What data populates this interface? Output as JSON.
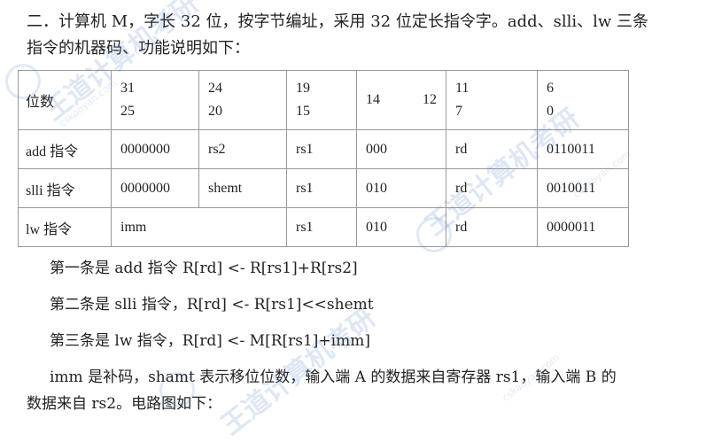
{
  "intro": {
    "line1": "二．计算机 M，字长 32 位，按字节编址，采用 32 位定长指令字。add、slli、lw 三条",
    "line2": "指令的机器码、功能说明如下："
  },
  "table": {
    "header": {
      "label": "位数",
      "bits": [
        {
          "hi": "31",
          "lo": "25"
        },
        {
          "hi": "24",
          "lo": "20"
        },
        {
          "hi": "19",
          "lo": "15"
        },
        {
          "hi": "14",
          "lo": "12"
        },
        {
          "hi": "11",
          "lo": "7"
        },
        {
          "hi": "6",
          "lo": "0"
        }
      ]
    },
    "rows": [
      {
        "label": "add 指令",
        "cells": [
          "0000000",
          "rs2",
          "rs1",
          "000",
          "rd",
          "0110011"
        ]
      },
      {
        "label": "slli 指令",
        "cells": [
          "0000000",
          "shemt",
          "rs1",
          "010",
          "rd",
          "0010011"
        ]
      },
      {
        "label": "lw 指令",
        "cells": [
          "imm",
          "rs1",
          "010",
          "rd",
          "0000011"
        ]
      }
    ]
  },
  "lines": {
    "l1": "第一条是 add 指令  R[rd] <- R[rs1]+R[rs2]",
    "l2": "第二条是 slli 指令，R[rd] <- R[rs1]<<shemt",
    "l3": "第三条是 lw 指令，R[rd] <- M[R[rs1]+imm]",
    "l4": "imm 是补码，shamt 表示移位位数，输入端 A 的数据来自寄存器 rs1，输入端 B 的",
    "l5": "数据来自 rs2。电路图如下："
  },
  "watermark": {
    "text": "王道计算机考研",
    "url": "cskaoyan.com"
  }
}
